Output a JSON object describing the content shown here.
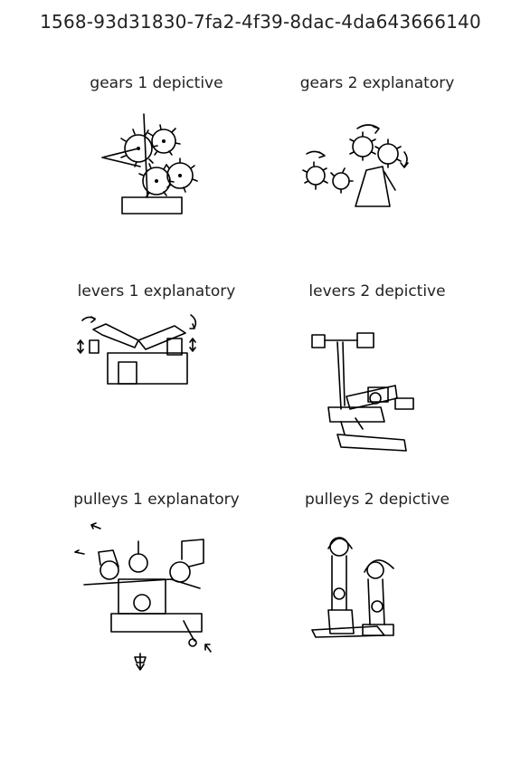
{
  "title": "1568-93d31830-7fa2-4f39-8dac-4da643666140",
  "panels": [
    {
      "label": "gears 1 depictive"
    },
    {
      "label": "gears 2 explanatory"
    },
    {
      "label": "levers 1 explanatory"
    },
    {
      "label": "levers 2 depictive"
    },
    {
      "label": "pulleys 1 explanatory"
    },
    {
      "label": "pulleys 2 depictive"
    }
  ]
}
